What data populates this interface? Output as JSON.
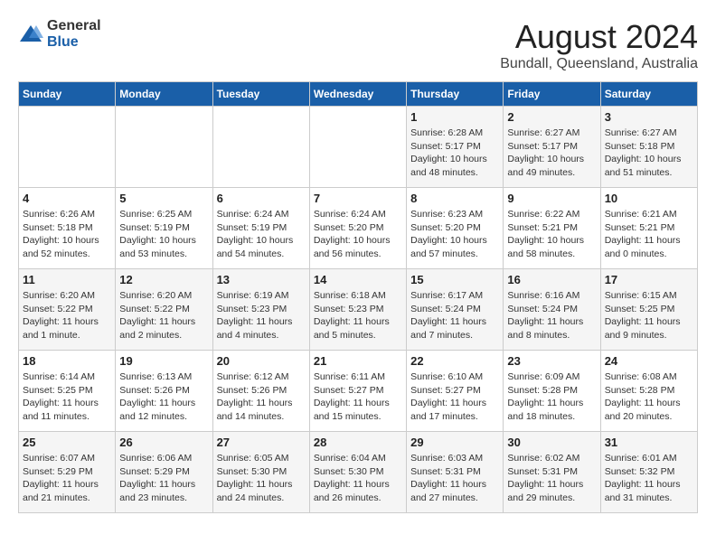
{
  "header": {
    "logo_general": "General",
    "logo_blue": "Blue",
    "title": "August 2024",
    "subtitle": "Bundall, Queensland, Australia"
  },
  "days_of_week": [
    "Sunday",
    "Monday",
    "Tuesday",
    "Wednesday",
    "Thursday",
    "Friday",
    "Saturday"
  ],
  "weeks": [
    [
      {
        "day": "",
        "info": ""
      },
      {
        "day": "",
        "info": ""
      },
      {
        "day": "",
        "info": ""
      },
      {
        "day": "",
        "info": ""
      },
      {
        "day": "1",
        "info": "Sunrise: 6:28 AM\nSunset: 5:17 PM\nDaylight: 10 hours and 48 minutes."
      },
      {
        "day": "2",
        "info": "Sunrise: 6:27 AM\nSunset: 5:17 PM\nDaylight: 10 hours and 49 minutes."
      },
      {
        "day": "3",
        "info": "Sunrise: 6:27 AM\nSunset: 5:18 PM\nDaylight: 10 hours and 51 minutes."
      }
    ],
    [
      {
        "day": "4",
        "info": "Sunrise: 6:26 AM\nSunset: 5:18 PM\nDaylight: 10 hours and 52 minutes."
      },
      {
        "day": "5",
        "info": "Sunrise: 6:25 AM\nSunset: 5:19 PM\nDaylight: 10 hours and 53 minutes."
      },
      {
        "day": "6",
        "info": "Sunrise: 6:24 AM\nSunset: 5:19 PM\nDaylight: 10 hours and 54 minutes."
      },
      {
        "day": "7",
        "info": "Sunrise: 6:24 AM\nSunset: 5:20 PM\nDaylight: 10 hours and 56 minutes."
      },
      {
        "day": "8",
        "info": "Sunrise: 6:23 AM\nSunset: 5:20 PM\nDaylight: 10 hours and 57 minutes."
      },
      {
        "day": "9",
        "info": "Sunrise: 6:22 AM\nSunset: 5:21 PM\nDaylight: 10 hours and 58 minutes."
      },
      {
        "day": "10",
        "info": "Sunrise: 6:21 AM\nSunset: 5:21 PM\nDaylight: 11 hours and 0 minutes."
      }
    ],
    [
      {
        "day": "11",
        "info": "Sunrise: 6:20 AM\nSunset: 5:22 PM\nDaylight: 11 hours and 1 minute."
      },
      {
        "day": "12",
        "info": "Sunrise: 6:20 AM\nSunset: 5:22 PM\nDaylight: 11 hours and 2 minutes."
      },
      {
        "day": "13",
        "info": "Sunrise: 6:19 AM\nSunset: 5:23 PM\nDaylight: 11 hours and 4 minutes."
      },
      {
        "day": "14",
        "info": "Sunrise: 6:18 AM\nSunset: 5:23 PM\nDaylight: 11 hours and 5 minutes."
      },
      {
        "day": "15",
        "info": "Sunrise: 6:17 AM\nSunset: 5:24 PM\nDaylight: 11 hours and 7 minutes."
      },
      {
        "day": "16",
        "info": "Sunrise: 6:16 AM\nSunset: 5:24 PM\nDaylight: 11 hours and 8 minutes."
      },
      {
        "day": "17",
        "info": "Sunrise: 6:15 AM\nSunset: 5:25 PM\nDaylight: 11 hours and 9 minutes."
      }
    ],
    [
      {
        "day": "18",
        "info": "Sunrise: 6:14 AM\nSunset: 5:25 PM\nDaylight: 11 hours and 11 minutes."
      },
      {
        "day": "19",
        "info": "Sunrise: 6:13 AM\nSunset: 5:26 PM\nDaylight: 11 hours and 12 minutes."
      },
      {
        "day": "20",
        "info": "Sunrise: 6:12 AM\nSunset: 5:26 PM\nDaylight: 11 hours and 14 minutes."
      },
      {
        "day": "21",
        "info": "Sunrise: 6:11 AM\nSunset: 5:27 PM\nDaylight: 11 hours and 15 minutes."
      },
      {
        "day": "22",
        "info": "Sunrise: 6:10 AM\nSunset: 5:27 PM\nDaylight: 11 hours and 17 minutes."
      },
      {
        "day": "23",
        "info": "Sunrise: 6:09 AM\nSunset: 5:28 PM\nDaylight: 11 hours and 18 minutes."
      },
      {
        "day": "24",
        "info": "Sunrise: 6:08 AM\nSunset: 5:28 PM\nDaylight: 11 hours and 20 minutes."
      }
    ],
    [
      {
        "day": "25",
        "info": "Sunrise: 6:07 AM\nSunset: 5:29 PM\nDaylight: 11 hours and 21 minutes."
      },
      {
        "day": "26",
        "info": "Sunrise: 6:06 AM\nSunset: 5:29 PM\nDaylight: 11 hours and 23 minutes."
      },
      {
        "day": "27",
        "info": "Sunrise: 6:05 AM\nSunset: 5:30 PM\nDaylight: 11 hours and 24 minutes."
      },
      {
        "day": "28",
        "info": "Sunrise: 6:04 AM\nSunset: 5:30 PM\nDaylight: 11 hours and 26 minutes."
      },
      {
        "day": "29",
        "info": "Sunrise: 6:03 AM\nSunset: 5:31 PM\nDaylight: 11 hours and 27 minutes."
      },
      {
        "day": "30",
        "info": "Sunrise: 6:02 AM\nSunset: 5:31 PM\nDaylight: 11 hours and 29 minutes."
      },
      {
        "day": "31",
        "info": "Sunrise: 6:01 AM\nSunset: 5:32 PM\nDaylight: 11 hours and 31 minutes."
      }
    ]
  ]
}
